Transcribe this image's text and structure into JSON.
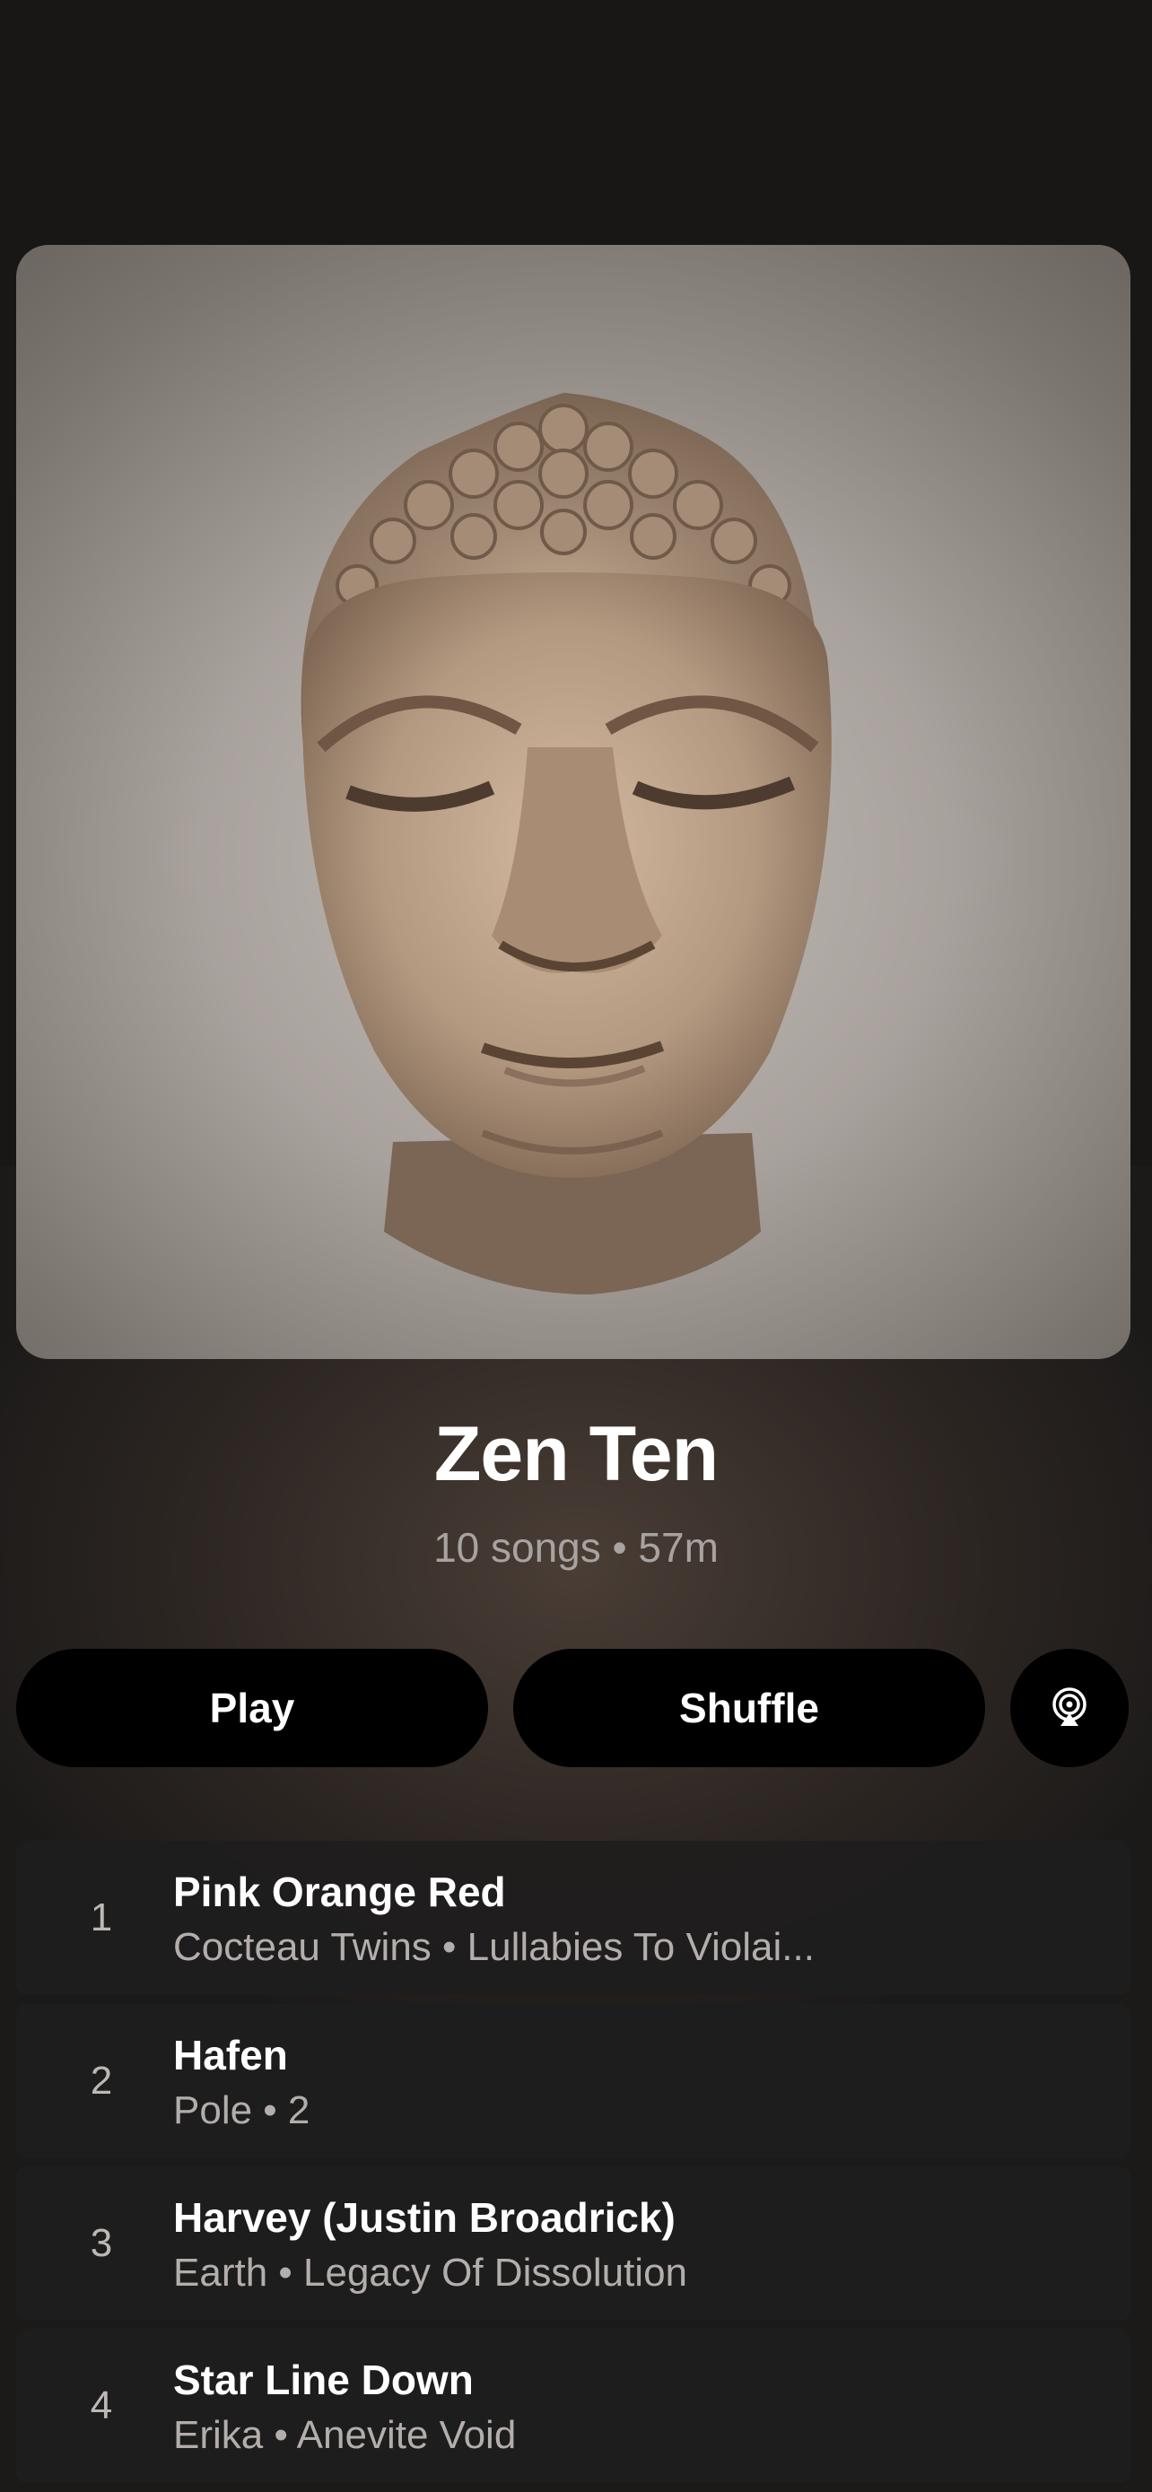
{
  "playlist": {
    "title": "Zen Ten",
    "meta": "10 songs • 57m"
  },
  "artwork": {
    "icon": "buddha-head-artwork"
  },
  "actions": {
    "play_label": "Play",
    "shuffle_label": "Shuffle",
    "airplay_icon": "airplay-audio-icon"
  },
  "tracks": [
    {
      "number": "1",
      "title": "Pink Orange Red",
      "subtitle": "Cocteau Twins • Lullabies To Violai..."
    },
    {
      "number": "2",
      "title": "Hafen",
      "subtitle": "Pole • 2"
    },
    {
      "number": "3",
      "title": "Harvey (Justin Broadrick)",
      "subtitle": "Earth • Legacy Of Dissolution"
    },
    {
      "number": "4",
      "title": "Star Line Down",
      "subtitle": "Erika • Anevite Void"
    }
  ]
}
